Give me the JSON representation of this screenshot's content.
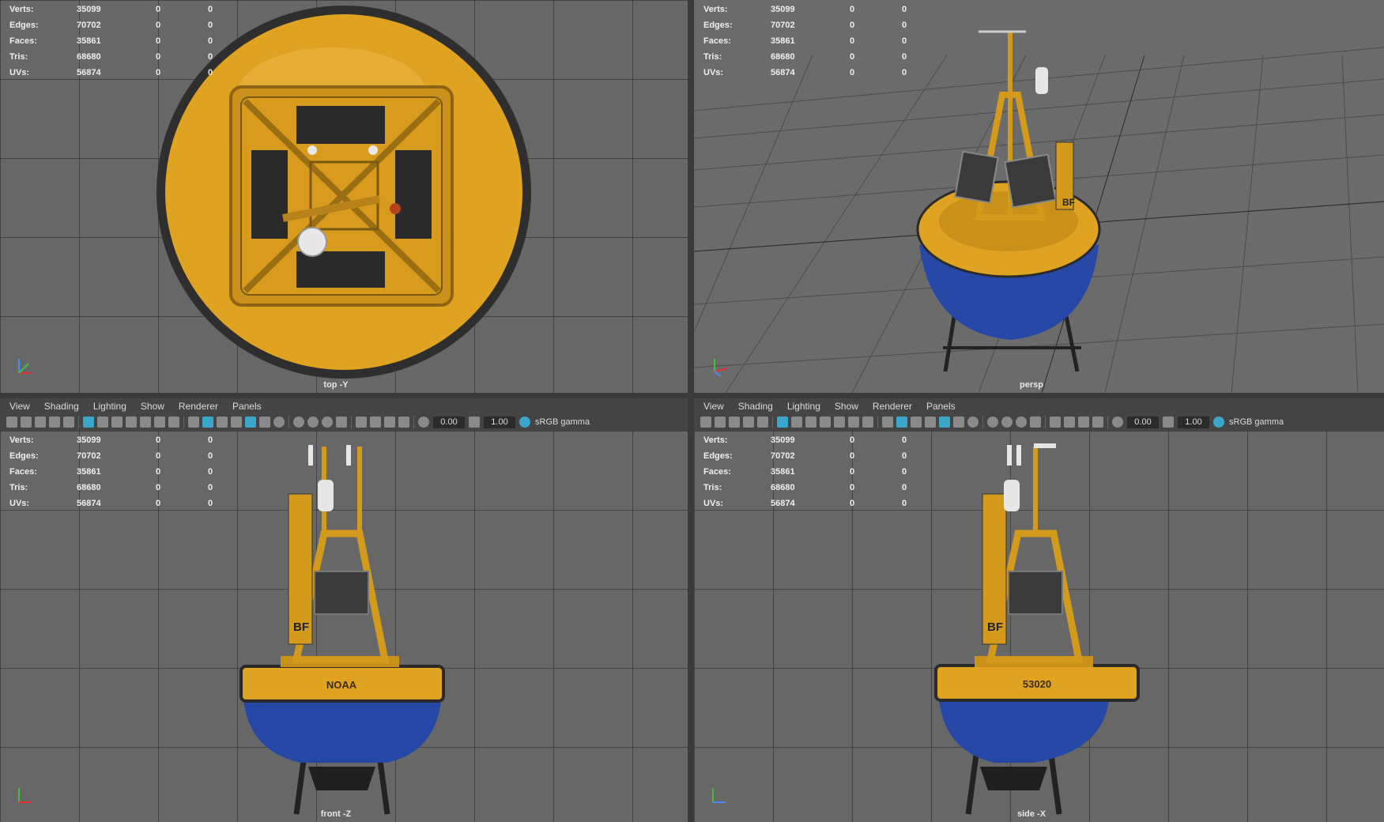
{
  "stats": {
    "rows": [
      {
        "label": "Verts:",
        "v1": "35099",
        "v2": "0",
        "v3": "0"
      },
      {
        "label": "Edges:",
        "v1": "70702",
        "v2": "0",
        "v3": "0"
      },
      {
        "label": "Faces:",
        "v1": "35861",
        "v2": "0",
        "v3": "0"
      },
      {
        "label": "Tris:",
        "v1": "68680",
        "v2": "0",
        "v3": "0"
      },
      {
        "label": "UVs:",
        "v1": "56874",
        "v2": "0",
        "v3": "0"
      }
    ]
  },
  "viewports": {
    "top": {
      "camera": "top -Y"
    },
    "persp": {
      "camera": "persp"
    },
    "front": {
      "camera": "front -Z"
    },
    "side": {
      "camera": "side -X"
    }
  },
  "menu": [
    "View",
    "Shading",
    "Lighting",
    "Show",
    "Renderer",
    "Panels"
  ],
  "toolbar": {
    "exposure": "0.00",
    "gamma": "1.00",
    "color_space": "sRGB gamma"
  },
  "model": {
    "hull_text_front": "NOAA",
    "hull_text_side": "53020",
    "tower_label": "BF",
    "colors": {
      "hull_top": "#e0a321",
      "hull_bottom": "#2747a6",
      "metal": "#2a2a2a"
    }
  }
}
